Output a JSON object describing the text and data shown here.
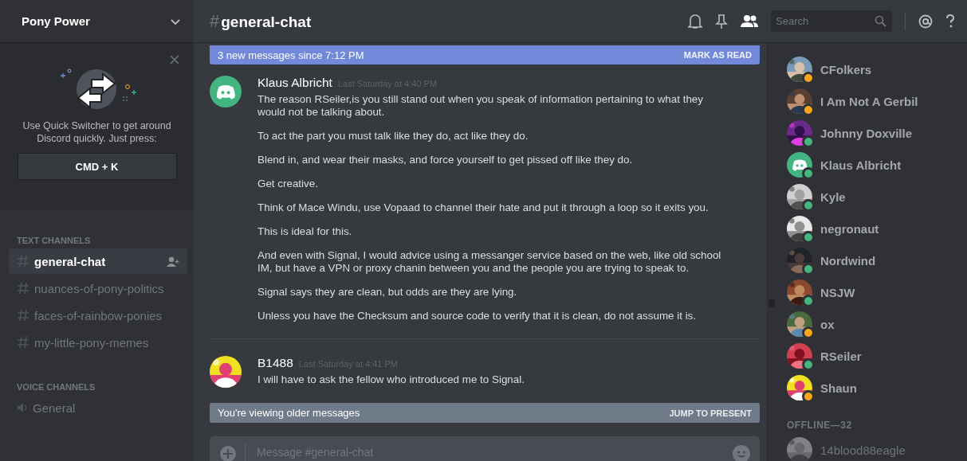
{
  "server": {
    "name": "Pony Power"
  },
  "quick_switcher": {
    "text": "Use Quick Switcher to get around Discord quickly. Just press:",
    "shortcut": "CMD + K"
  },
  "channel_groups": [
    {
      "title": "TEXT CHANNELS",
      "kind": "text",
      "channels": [
        {
          "name": "general-chat",
          "selected": true
        },
        {
          "name": "nuances-of-pony-politics",
          "selected": false
        },
        {
          "name": "faces-of-rainbow-ponies",
          "selected": false
        },
        {
          "name": "my-little-pony-memes",
          "selected": false
        }
      ]
    },
    {
      "title": "VOICE CHANNELS",
      "kind": "voice",
      "channels": [
        {
          "name": "General",
          "selected": false
        }
      ]
    }
  ],
  "header": {
    "prefix": "#",
    "channel": "general-chat",
    "search": {
      "placeholder": "Search"
    }
  },
  "new_messages_bar": {
    "text": "3 new messages since 7:12 PM",
    "action": "MARK AS READ"
  },
  "messages": [
    {
      "author": "Klaus Albricht",
      "timestamp": "Last Saturday at 4:40 PM",
      "kind": "logo",
      "paragraphs": [
        "The reason RSeiler,is you still stand out when you speak of information pertaining to what they would not be talking about.",
        "To act the part you must talk like they do, act like they do.",
        "Blend in, and wear their masks, and force yourself to get pissed off like they do.",
        "Get creative.",
        "Think of Mace Windu, use Vopaad to channel their hate and put it through a loop so it exits you.",
        "This is ideal for this.",
        "And even with Signal, I would advice using a messanger service based on the web, like old school IM, but have a VPN or proxy chanin between you and the people you are trying to speak to.",
        "Signal says they are clean, but odds are they are lying.",
        "Unless you have the Checksum and source code to verify that it is clean, do not assume it is."
      ]
    },
    {
      "author": "B1488",
      "timestamp": "Last Saturday at 4:41 PM",
      "kind": "picture",
      "paragraphs": [
        "I will have to ask the fellow who introduced me to Signal."
      ]
    }
  ],
  "older_messages_bar": {
    "text": "You're viewing older messages",
    "action": "JUMP TO PRESENT"
  },
  "composer": {
    "placeholder": "Message #general-chat"
  },
  "members": [
    {
      "name": "CFolkers",
      "kind": "picture",
      "color": "#faa61a"
    },
    {
      "name": "I Am Not A Gerbil",
      "kind": "picture",
      "color": "#faa61a"
    },
    {
      "name": "Johnny Doxville",
      "kind": "picture",
      "color": "#43b581"
    },
    {
      "name": "Klaus Albricht",
      "kind": "logo",
      "color": "#43b581"
    },
    {
      "name": "Kyle",
      "kind": "picture",
      "color": "#43b581"
    },
    {
      "name": "negronaut",
      "kind": "picture",
      "color": "#43b581"
    },
    {
      "name": "Nordwind",
      "kind": "picture",
      "color": "#43b581"
    },
    {
      "name": "NSJW",
      "kind": "picture",
      "color": "#43b581"
    },
    {
      "name": "ox",
      "kind": "picture",
      "color": "#faa61a"
    },
    {
      "name": "RSeiler",
      "kind": "picture",
      "color": "#43b581"
    },
    {
      "name": "Shaun",
      "kind": "picture",
      "color": "#faa61a"
    }
  ],
  "offline": {
    "title": "OFFLINE—32",
    "members": [
      {
        "name": "14blood88eagle",
        "kind": "picture"
      }
    ]
  }
}
